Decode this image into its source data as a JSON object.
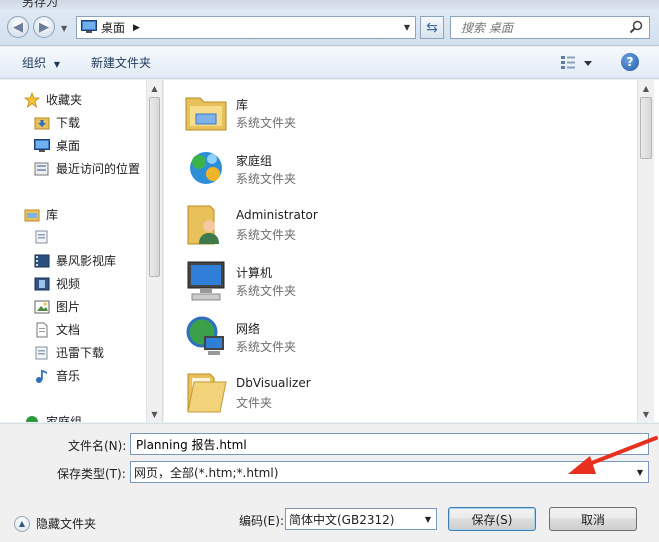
{
  "title": "另存为",
  "address": {
    "location": "桌面",
    "search_placeholder": "搜索 桌面"
  },
  "toolbar": {
    "organize": "组织",
    "new_folder": "新建文件夹",
    "help": "?"
  },
  "nav": {
    "favorites": "收藏夹",
    "downloads": "下载",
    "desktop": "桌面",
    "recent": "最近访问的位置",
    "library": "库",
    "baofeng": "暴风影视库",
    "video": "视频",
    "pictures": "图片",
    "documents": "文档",
    "xunlei": "迅雷下载",
    "music": "音乐",
    "homegroup": "家庭组"
  },
  "files": [
    {
      "name": "库",
      "type": "系统文件夹",
      "icon": "library-icon"
    },
    {
      "name": "家庭组",
      "type": "系统文件夹",
      "icon": "homegroup-icon"
    },
    {
      "name": "Administrator",
      "type": "系统文件夹",
      "icon": "user-folder-icon"
    },
    {
      "name": "计算机",
      "type": "系统文件夹",
      "icon": "computer-icon"
    },
    {
      "name": "网络",
      "type": "系统文件夹",
      "icon": "network-icon"
    },
    {
      "name": "DbVisualizer",
      "type": "文件夹",
      "icon": "folder-icon"
    }
  ],
  "form": {
    "filename_label": "文件名(N):",
    "filename_value": "Planning 报告.html",
    "filetype_label": "保存类型(T):",
    "filetype_value": "网页，全部(*.htm;*.html)",
    "hide_folders": "隐藏文件夹",
    "encoding_label": "编码(E):",
    "encoding_value": "简体中文(GB2312)",
    "save": "保存(S)",
    "cancel": "取消"
  },
  "colors": {
    "annotation_arrow": "#e8301f",
    "link_text": "#1e395b"
  }
}
